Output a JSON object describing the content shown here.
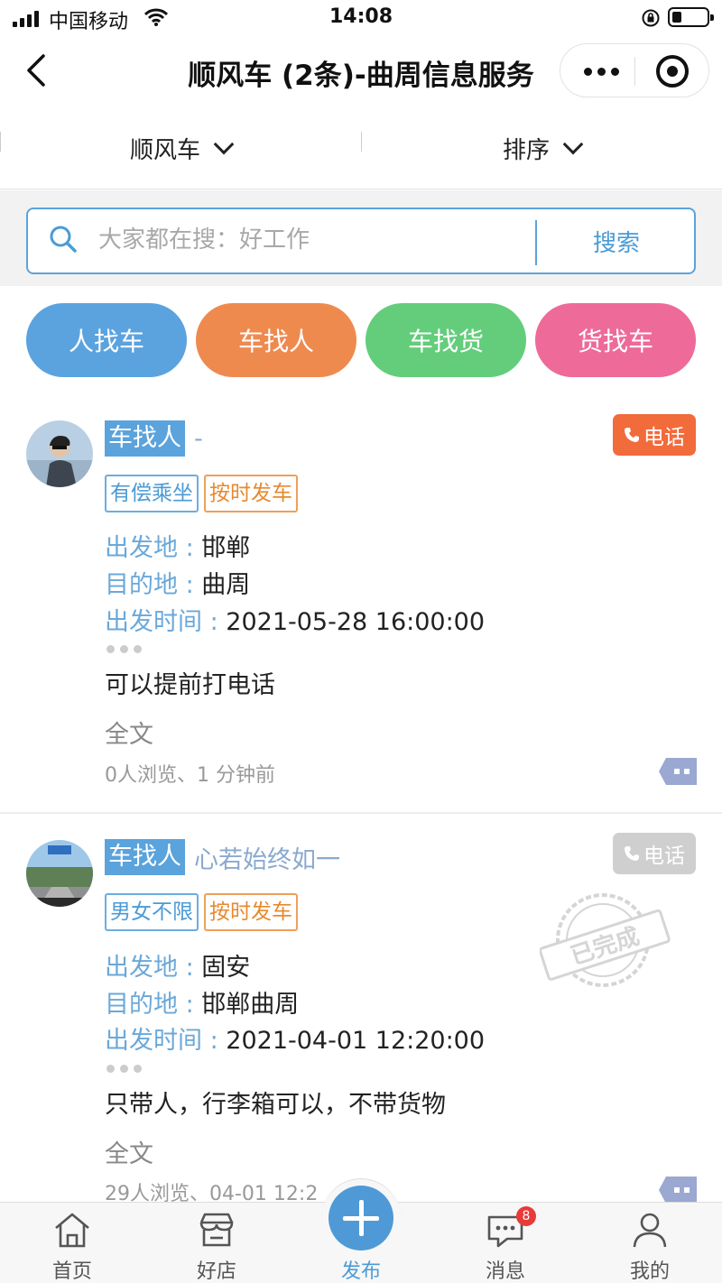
{
  "status_bar": {
    "carrier": "中国移动",
    "time": "14:08"
  },
  "nav": {
    "title": "顺风车 (2条)-曲周信息服务"
  },
  "filters": [
    {
      "label": "顺风车"
    },
    {
      "label": "排序"
    }
  ],
  "search": {
    "placeholder": "大家都在搜：好工作",
    "button": "搜索"
  },
  "categories": [
    {
      "label": "人找车",
      "color": "#5ba3df"
    },
    {
      "label": "车找人",
      "color": "#ef8a4f"
    },
    {
      "label": "车找货",
      "color": "#63cd7b"
    },
    {
      "label": "货找车",
      "color": "#ee6a98"
    }
  ],
  "posts": [
    {
      "type": "车找人",
      "user": "-",
      "call": "电话",
      "call_color": "#f26b3b",
      "tags": [
        "有偿乘坐",
        "按时发车"
      ],
      "from_key": "出发地 :",
      "from": "邯郸",
      "to_key": "目的地 :",
      "to": "曲周",
      "time_key": "出发时间 :",
      "time": "2021-05-28 16:00:00",
      "desc": "可以提前打电话",
      "fulltext": "全文",
      "meta": "0人浏览、1 分钟前"
    },
    {
      "type": "车找人",
      "user": "心若始终如一",
      "call": "电话",
      "call_color": "#cfcfcf",
      "tags": [
        "男女不限",
        "按时发车"
      ],
      "from_key": "出发地 :",
      "from": "固安",
      "to_key": "目的地 :",
      "to": "邯郸曲周",
      "time_key": "出发时间 :",
      "time": "2021-04-01 12:20:00",
      "desc": "只带人，行李箱可以，不带货物",
      "fulltext": "全文",
      "meta": "29人浏览、04-01 12:2",
      "stamp": "已完成"
    }
  ],
  "tabbar": [
    {
      "label": "首页",
      "icon": "home-icon"
    },
    {
      "label": "好店",
      "icon": "shop-icon"
    },
    {
      "label": "发布",
      "icon": "plus-icon"
    },
    {
      "label": "消息",
      "icon": "message-icon",
      "badge": "8"
    },
    {
      "label": "我的",
      "icon": "user-icon"
    }
  ]
}
